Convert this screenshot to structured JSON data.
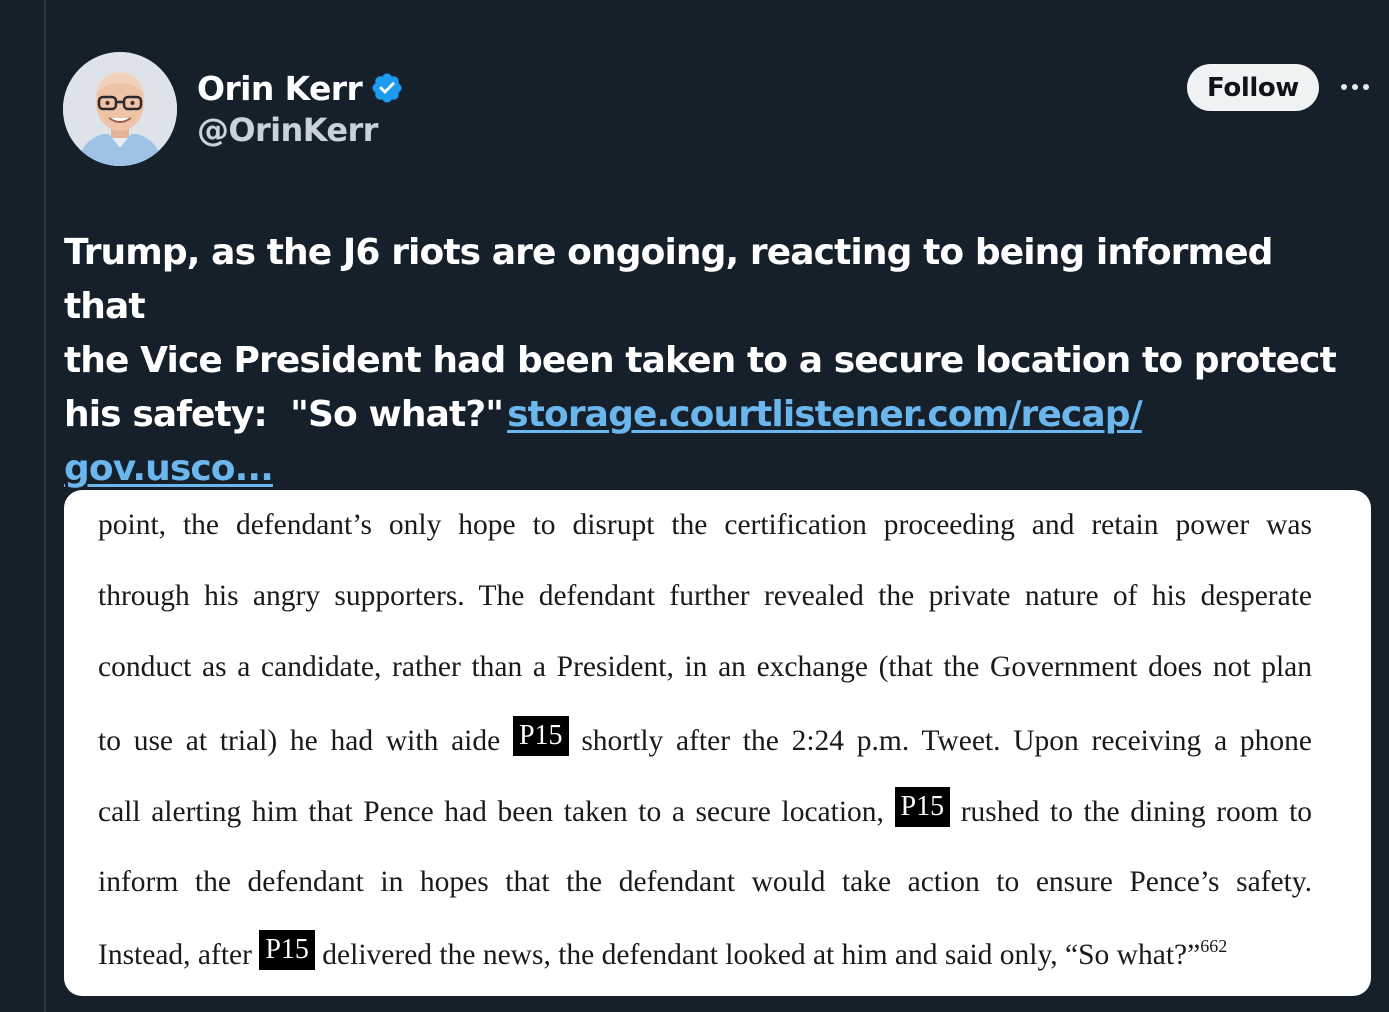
{
  "author": {
    "display_name": "Orin Kerr",
    "handle": "@OrinKerr",
    "verified": true,
    "verified_icon": "verified-badge-icon",
    "avatar_icon": "avatar"
  },
  "actions": {
    "follow_label": "Follow",
    "more_icon": "more-options-icon"
  },
  "tweet": {
    "text": "Trump, as the J6 riots are ongoing, reacting to being informed that the Vice President had been taken to a secure location to protect his safety:  \"So what?\"",
    "line1": "Trump, as the J6 riots are ongoing, reacting to being informed that",
    "line2": "the Vice President had been taken to a secure location to protect",
    "line3": "his safety:  \"So what?\"",
    "link_part1": "storage.courtlistener.com/recap/",
    "link_part2": "gov.usco..."
  },
  "document_image": {
    "lines": [
      {
        "text": "point, the defendant’s only hope to disrupt the certification proceeding and retain power was"
      },
      {
        "text": "through his angry supporters.  The defendant further revealed the private nature of his desperate"
      },
      {
        "text": "conduct as a candidate, rather than a President, in an exchange (that the Government does not plan"
      },
      {
        "before": "to use at trial) he had with aide",
        "redaction": "P15",
        "after": "shortly after the 2:24 p.m. Tweet.  Upon receiving a phone"
      },
      {
        "before": "call alerting him that Pence had been taken to a secure location,",
        "redaction": "P15",
        "after": "rushed to the dining room to"
      },
      {
        "text": "inform the defendant in hopes that the defendant would take action to ensure Pence’s safety."
      },
      {
        "before": "Instead, after",
        "redaction": "P15",
        "after": "delivered the news, the defendant looked at him and said only, “So what?”",
        "footnote": "662"
      }
    ]
  }
}
